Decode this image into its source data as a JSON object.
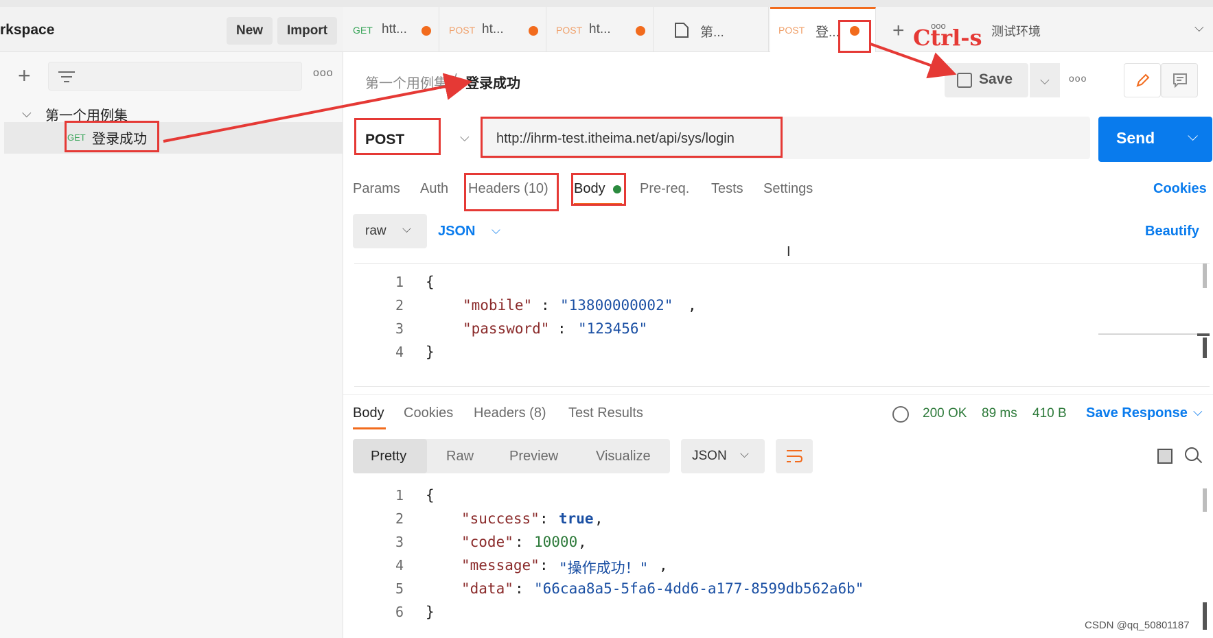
{
  "sidebar": {
    "workspace_title": "rkspace",
    "new_label": "New",
    "import_label": "Import",
    "more_label": "ooo",
    "collection_name": "第一个用例集",
    "request": {
      "method": "GET",
      "name": "登录成功"
    }
  },
  "tabs": [
    {
      "method": "GET",
      "name": "htt...",
      "unsaved": true
    },
    {
      "method": "POST",
      "name": "ht...",
      "unsaved": true
    },
    {
      "method": "POST",
      "name": "ht...",
      "unsaved": true
    },
    {
      "method": "",
      "name": "第...",
      "unsaved": false
    },
    {
      "method": "POST",
      "name": "登...",
      "unsaved": true,
      "active": true
    }
  ],
  "tab_bar": {
    "more_label": "ooo",
    "environment": "测试环境"
  },
  "annotation": {
    "shortcut": "Ctrl-s"
  },
  "breadcrumb": {
    "parent": "第一个用例集",
    "separator": "/",
    "current": "登录成功"
  },
  "toolbar": {
    "save_label": "Save",
    "more_label": "ooo"
  },
  "request_line": {
    "method": "POST",
    "url": "http://ihrm-test.itheima.net/api/sys/login",
    "send_label": "Send"
  },
  "request_tabs": {
    "params": "Params",
    "auth": "Auth",
    "headers": "Headers (10)",
    "body": "Body",
    "prereq": "Pre-req.",
    "tests": "Tests",
    "settings": "Settings",
    "cookies": "Cookies"
  },
  "body_mode": {
    "raw": "raw",
    "format": "JSON",
    "beautify": "Beautify"
  },
  "request_body": {
    "line_numbers": [
      "1",
      "2",
      "3",
      "4"
    ],
    "open": "{",
    "close": "}",
    "fields": [
      {
        "key": "\"mobile\"",
        "value": "\"13800000002\"",
        "trail": ","
      },
      {
        "key": "\"password\"",
        "value": "\"123456\"",
        "trail": ""
      }
    ]
  },
  "response_tabs": {
    "body": "Body",
    "cookies": "Cookies",
    "headers": "Headers (8)",
    "tests": "Test Results",
    "save_response": "Save Response"
  },
  "response_status": {
    "code": "200 OK",
    "time": "89 ms",
    "size": "410 B"
  },
  "response_view": {
    "pretty": "Pretty",
    "raw": "Raw",
    "preview": "Preview",
    "visualize": "Visualize",
    "format": "JSON"
  },
  "response_body": {
    "line_numbers": [
      "1",
      "2",
      "3",
      "4",
      "5",
      "6"
    ],
    "open": "{",
    "close": "}",
    "success_key": "\"success\"",
    "success_val": "true",
    "code_key": "\"code\"",
    "code_val": "10000",
    "message_key": "\"message\"",
    "message_val": "\"操作成功！\"",
    "data_key": "\"data\"",
    "data_val": "\"66caa8a5-5fa6-4dd6-a177-8599db562a6b\""
  },
  "watermark": "CSDN @qq_50801187",
  "colors": {
    "accent": "#097bed",
    "unsaved_dot": "#f26b1d",
    "annotation": "#e53935"
  }
}
